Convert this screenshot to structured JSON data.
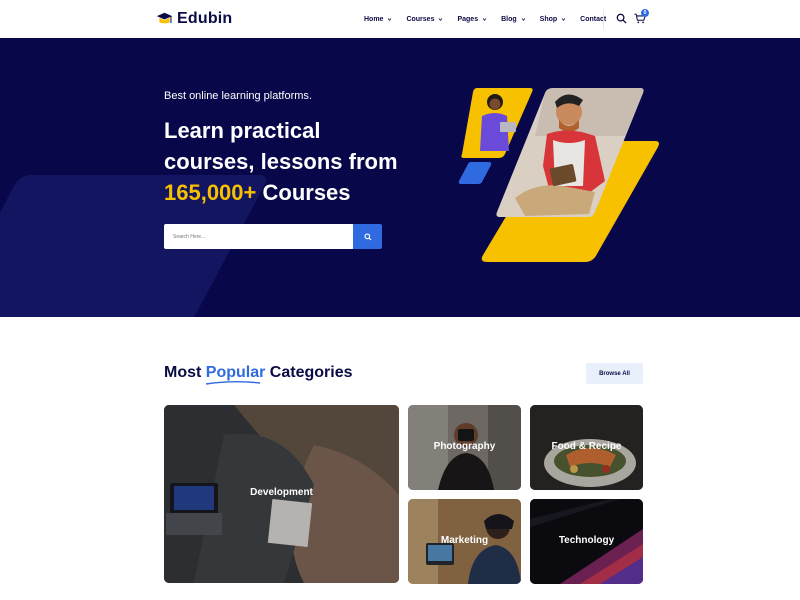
{
  "header": {
    "brand": "Edubin",
    "nav": [
      {
        "label": "Home",
        "has_dropdown": true
      },
      {
        "label": "Courses",
        "has_dropdown": true
      },
      {
        "label": "Pages",
        "has_dropdown": true
      },
      {
        "label": "Blog",
        "has_dropdown": true
      },
      {
        "label": "Shop",
        "has_dropdown": true
      },
      {
        "label": "Contact",
        "has_dropdown": false
      }
    ],
    "cart_count": "0",
    "icons": [
      "search-icon",
      "cart-icon"
    ]
  },
  "hero": {
    "subtitle": "Best online learning platforms.",
    "title_line1": "Learn practical",
    "title_line2": "courses, lessons from",
    "title_highlight": "165,000+",
    "title_tail": " Courses",
    "search_placeholder": "Search Here...",
    "colors": {
      "background": "#07074a",
      "accent": "#f7c100",
      "button": "#2f6ae0"
    }
  },
  "categories": {
    "title_pre": "Most ",
    "title_highlight": "Popular",
    "title_post": " Categories",
    "browse_label": "Browse All",
    "items": [
      {
        "label": "Development"
      },
      {
        "label": "Photography"
      },
      {
        "label": "Food & Recipe"
      },
      {
        "label": "Marketing"
      },
      {
        "label": "Technology"
      }
    ]
  }
}
